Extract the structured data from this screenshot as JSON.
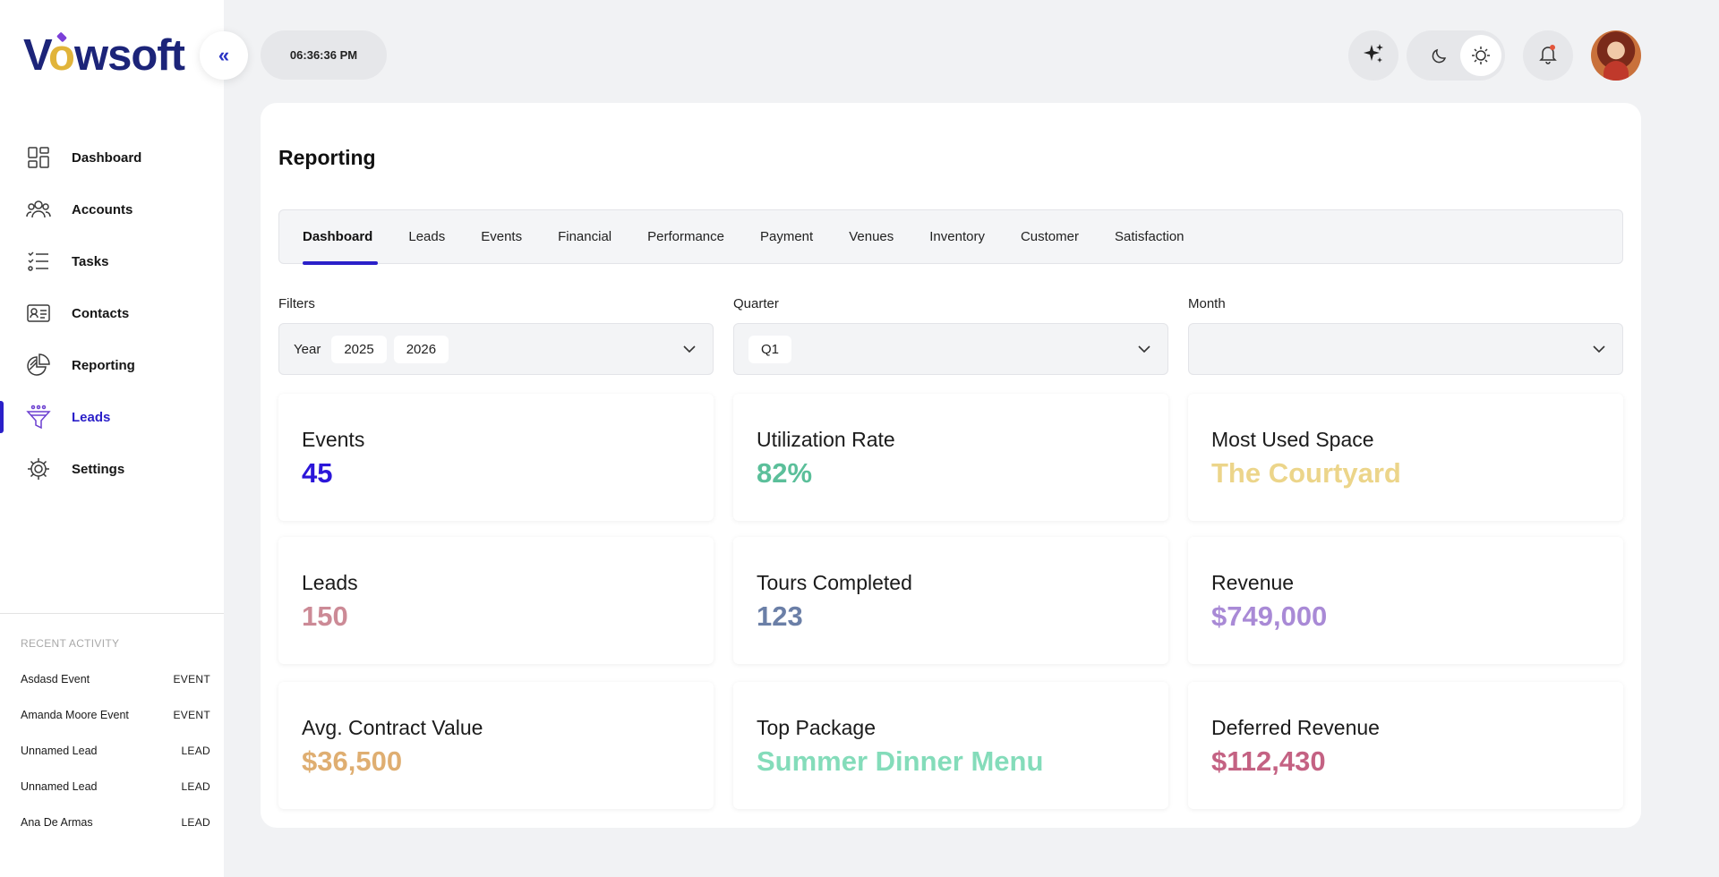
{
  "brand": {
    "logo_pre": "V",
    "logo_o": "o",
    "logo_post": "wsoft"
  },
  "sidebar": {
    "items": [
      {
        "label": "Dashboard",
        "icon": "dashboard-icon"
      },
      {
        "label": "Accounts",
        "icon": "people-icon"
      },
      {
        "label": "Tasks",
        "icon": "checklist-icon"
      },
      {
        "label": "Contacts",
        "icon": "contact-card-icon"
      },
      {
        "label": "Reporting",
        "icon": "pie-chart-icon"
      },
      {
        "label": "Leads",
        "icon": "funnel-icon",
        "active": true
      },
      {
        "label": "Settings",
        "icon": "gear-icon"
      }
    ],
    "recent_title": "RECENT ACTIVITY",
    "recent": [
      {
        "name": "Asdasd Event",
        "tag": "EVENT"
      },
      {
        "name": "Amanda Moore Event",
        "tag": "EVENT"
      },
      {
        "name": "Unnamed Lead",
        "tag": "LEAD"
      },
      {
        "name": "Unnamed Lead",
        "tag": "LEAD"
      },
      {
        "name": "Ana De Armas",
        "tag": "LEAD"
      }
    ]
  },
  "topbar": {
    "clock": "06:36:36  PM",
    "collapse_glyph": "«"
  },
  "page": {
    "title": "Reporting",
    "tabs": [
      "Dashboard",
      "Leads",
      "Events",
      "Financial",
      "Performance",
      "Payment",
      "Venues",
      "Inventory",
      "Customer",
      "Satisfaction"
    ],
    "active_tab": "Dashboard",
    "filters": {
      "filters_label": "Filters",
      "year_prefix": "Year",
      "year_chips": [
        "2025",
        "2026"
      ],
      "quarter_label": "Quarter",
      "quarter_chips": [
        "Q1"
      ],
      "month_label": "Month"
    },
    "stats": [
      {
        "label": "Events",
        "value": "45",
        "color": "#2b16d9"
      },
      {
        "label": "Utilization Rate",
        "value": "82%",
        "color": "#5bbf9a"
      },
      {
        "label": "Most Used Space",
        "value": "The Courtyard",
        "color": "#ecd58a"
      },
      {
        "label": "Leads",
        "value": "150",
        "color": "#cc8a96"
      },
      {
        "label": "Tours Completed",
        "value": "123",
        "color": "#6b7fa7"
      },
      {
        "label": "Revenue",
        "value": "$749,000",
        "color": "#a98ad6"
      },
      {
        "label": "Avg. Contract Value",
        "value": "$36,500",
        "color": "#dfae71"
      },
      {
        "label": "Top Package",
        "value": "Summer Dinner Menu",
        "color": "#84dcba"
      },
      {
        "label": "Deferred Revenue",
        "value": "$112,430",
        "color": "#c46283"
      }
    ]
  },
  "colors": {
    "accent": "#2b20c9",
    "notification_dot": "#e2553b"
  }
}
